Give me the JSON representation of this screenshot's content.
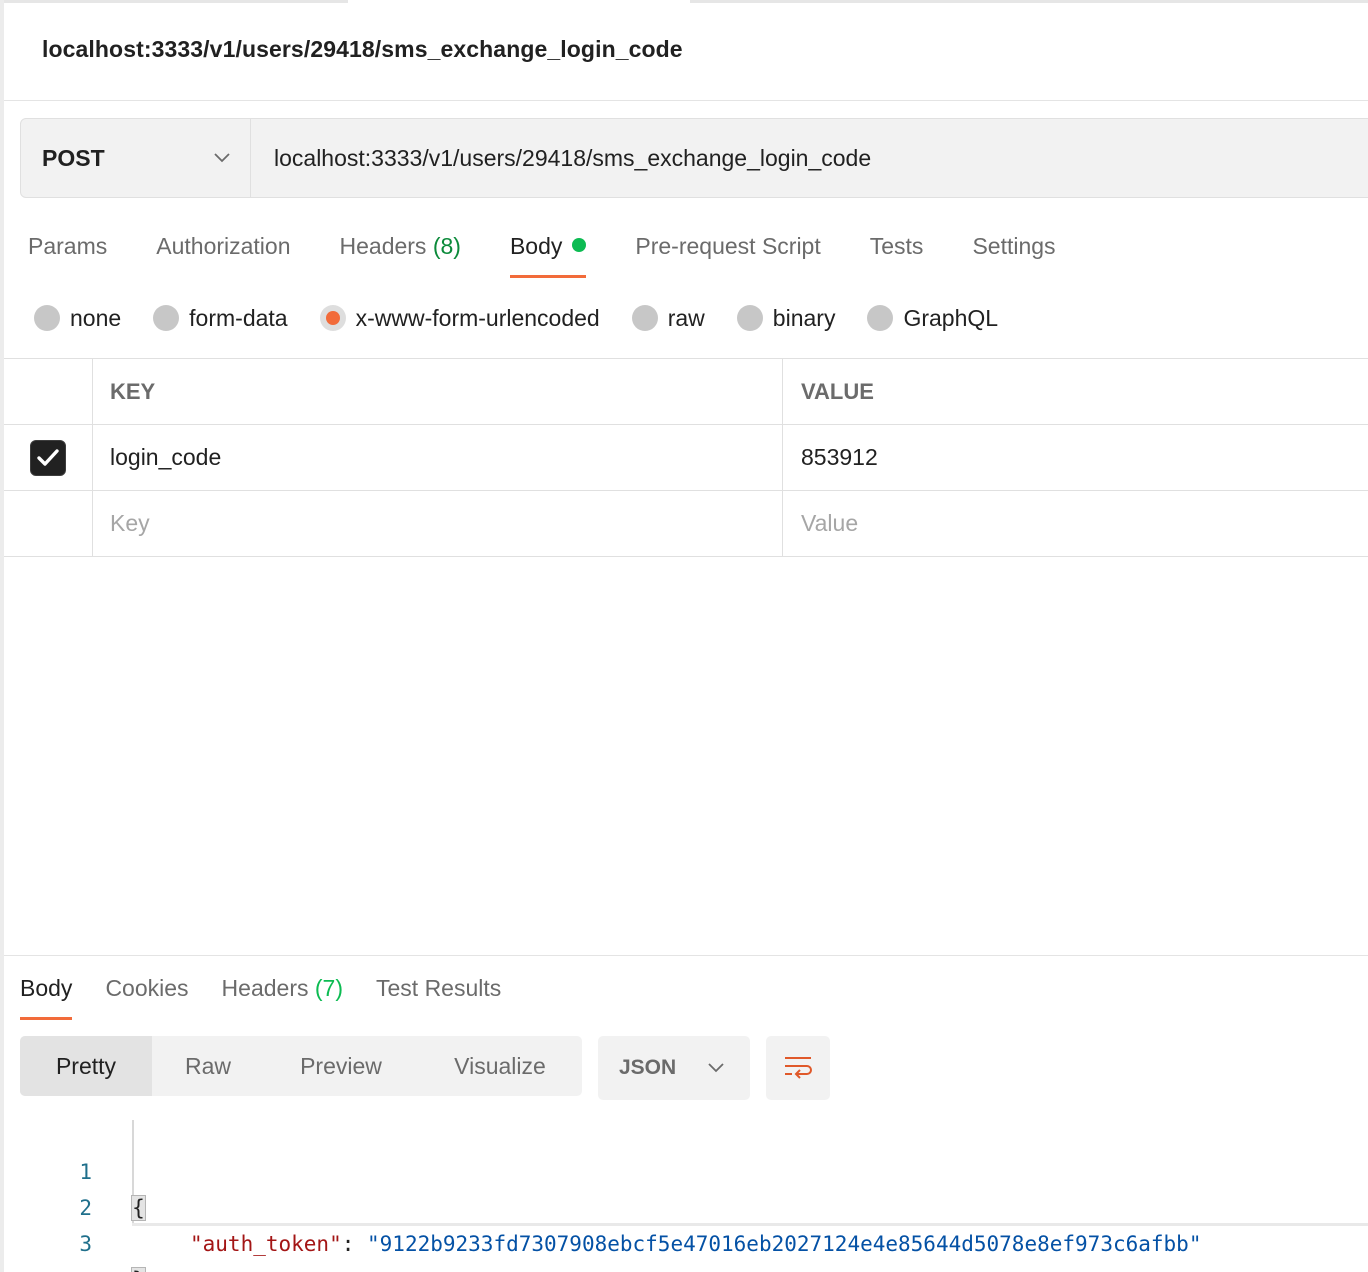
{
  "request": {
    "title": "localhost:3333/v1/users/29418/sms_exchange_login_code",
    "method": "POST",
    "url": "localhost:3333/v1/users/29418/sms_exchange_login_code"
  },
  "request_tabs": {
    "params": "Params",
    "authorization": "Authorization",
    "headers": "Headers",
    "headers_count": "(8)",
    "body": "Body",
    "prerequest": "Pre-request Script",
    "tests": "Tests",
    "settings": "Settings",
    "active": "Body"
  },
  "body_types": {
    "options": [
      "none",
      "form-data",
      "x-www-form-urlencoded",
      "raw",
      "binary",
      "GraphQL"
    ],
    "selected": "x-www-form-urlencoded"
  },
  "kv_table": {
    "key_header": "KEY",
    "value_header": "VALUE",
    "rows": [
      {
        "enabled": true,
        "key": "login_code",
        "value": "853912"
      }
    ],
    "key_placeholder": "Key",
    "value_placeholder": "Value"
  },
  "response_tabs": {
    "body": "Body",
    "cookies": "Cookies",
    "headers": "Headers",
    "headers_count": "(7)",
    "test_results": "Test Results",
    "active": "Body"
  },
  "view_modes": {
    "pretty": "Pretty",
    "raw": "Raw",
    "preview": "Preview",
    "visualize": "Visualize",
    "active": "Pretty"
  },
  "format": {
    "selected": "JSON"
  },
  "response_code": {
    "line_numbers": [
      "1",
      "2",
      "3"
    ],
    "open_brace": "{",
    "close_brace": "}",
    "key": "\"auth_token\"",
    "colon": ": ",
    "value": "\"9122b9233fd7307908ebcf5e47016eb2027124e4e85644d5078e8ef973c6afbb\""
  },
  "colors": {
    "accent": "#f26b3a",
    "success": "#0cbb52",
    "json_key": "#a31515",
    "json_string": "#0451a5",
    "line_number": "#1f6f8b"
  },
  "icons": {
    "method_dropdown": "chevron-down-icon",
    "format_dropdown": "chevron-down-icon",
    "wrap": "wrap-lines-icon",
    "checkbox": "check-icon"
  }
}
